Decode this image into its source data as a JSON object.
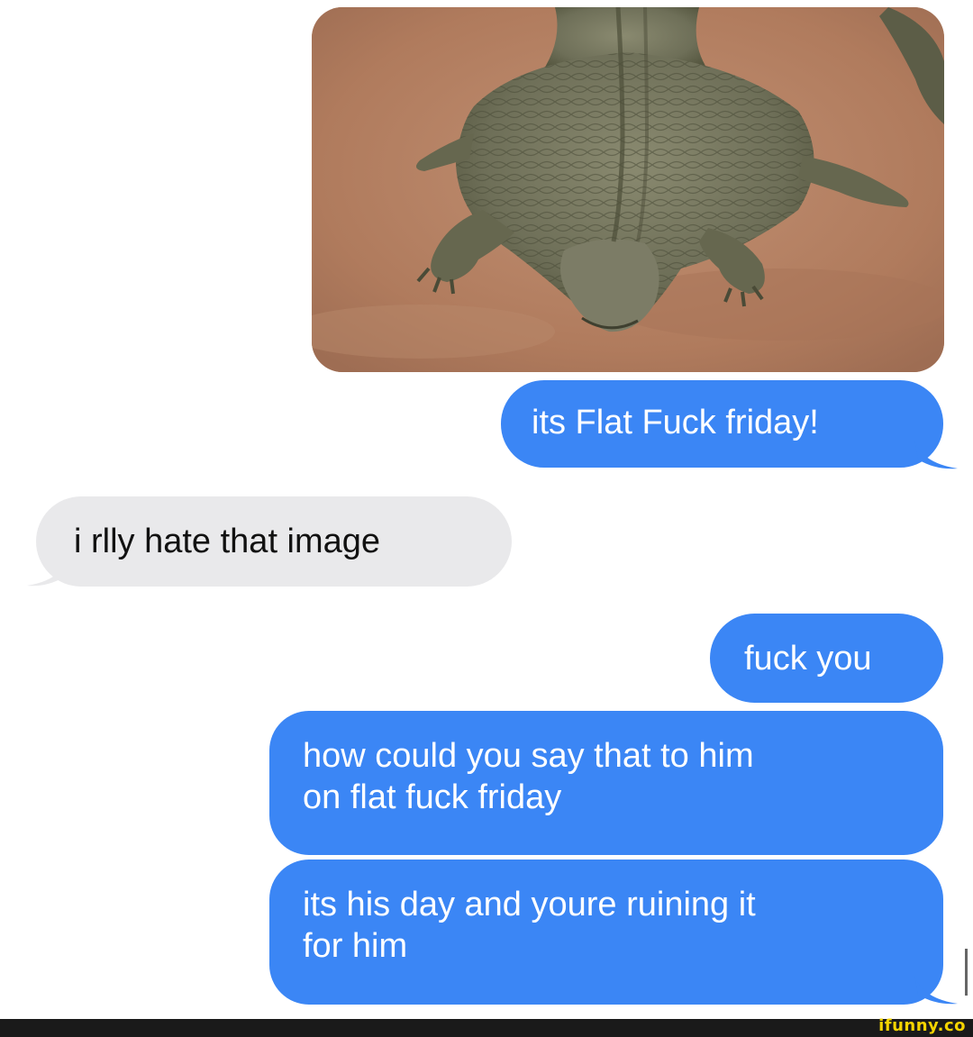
{
  "conversation": {
    "messages": [
      {
        "sender": "me",
        "type": "image",
        "image_subject": "crocodile lying flat on dirt"
      },
      {
        "sender": "me",
        "type": "text",
        "text": "its Flat Fuck friday!"
      },
      {
        "sender": "them",
        "type": "text",
        "text": "i rlly hate that image"
      },
      {
        "sender": "me",
        "type": "text",
        "text": "fuck you"
      },
      {
        "sender": "me",
        "type": "text",
        "text": "how could you say that to him\non flat fuck friday"
      },
      {
        "sender": "me",
        "type": "text",
        "text": "its his day and youre ruining it\nfor him"
      }
    ]
  },
  "watermark": {
    "text": "ifunny.co"
  },
  "colors": {
    "sent_bubble": "#3b86f5",
    "received_bubble": "#e9e9eb",
    "background": "#ffffff",
    "watermark": "#f5d400"
  }
}
